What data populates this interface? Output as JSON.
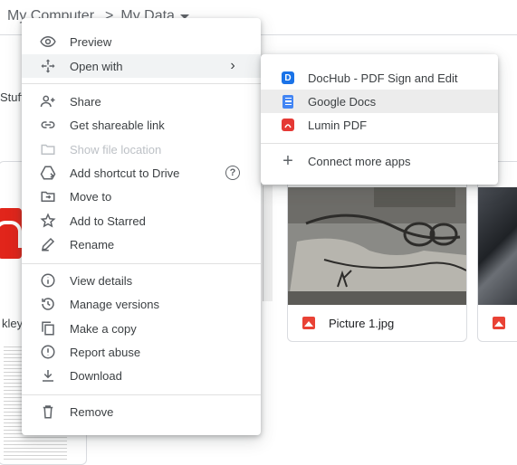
{
  "breadcrumb": {
    "items": [
      "My Computer",
      "My Data"
    ],
    "separator": ">"
  },
  "background": {
    "stuff_label": "Stuff",
    "left_file_text": "kley -",
    "file_name": "Picture 1.jpg"
  },
  "context_menu": {
    "items": [
      {
        "label": "Preview",
        "icon": "eye-icon"
      },
      {
        "label": "Open with",
        "icon": "move-arrows-icon",
        "submenu_arrow": "›"
      },
      {
        "label": "Share",
        "icon": "person-add-icon"
      },
      {
        "label": "Get shareable link",
        "icon": "link-icon"
      },
      {
        "label": "Show file location",
        "icon": "folder-icon",
        "disabled": true
      },
      {
        "label": "Add shortcut to Drive",
        "icon": "drive-shortcut-icon",
        "help": "?"
      },
      {
        "label": "Move to",
        "icon": "move-to-folder-icon"
      },
      {
        "label": "Add to Starred",
        "icon": "star-icon"
      },
      {
        "label": "Rename",
        "icon": "pencil-icon"
      },
      {
        "label": "View details",
        "icon": "info-icon"
      },
      {
        "label": "Manage versions",
        "icon": "history-icon"
      },
      {
        "label": "Make a copy",
        "icon": "copy-icon"
      },
      {
        "label": "Report abuse",
        "icon": "report-icon"
      },
      {
        "label": "Download",
        "icon": "download-icon"
      },
      {
        "label": "Remove",
        "icon": "trash-icon"
      }
    ]
  },
  "open_with_menu": {
    "items": [
      {
        "label": "DocHub - PDF Sign and Edit",
        "icon": "dochub-icon",
        "glyph": "D"
      },
      {
        "label": "Google Docs",
        "icon": "google-docs-icon",
        "highlighted": true
      },
      {
        "label": "Lumin PDF",
        "icon": "lumin-pdf-icon"
      },
      {
        "label": "Connect more apps",
        "icon": "plus-icon",
        "glyph": "+"
      }
    ]
  },
  "colors": {
    "highlight": "#f1f3f4",
    "dochub": "#1a73e8",
    "gdocs": "#4285f4",
    "lumin": "#e53935",
    "image_icon": "#e94235"
  }
}
